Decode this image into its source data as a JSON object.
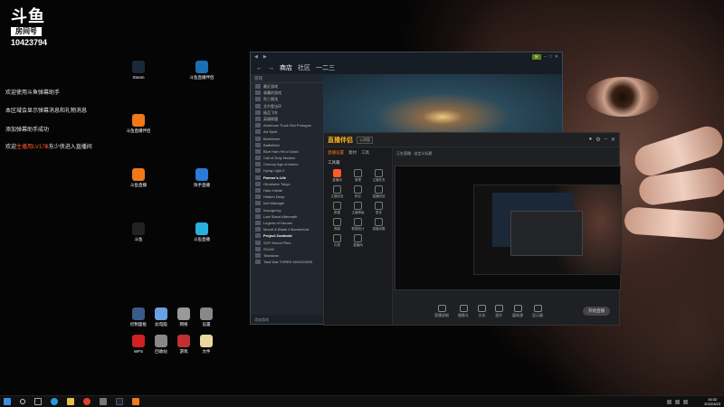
{
  "overlay": {
    "logo_text": "斗鱼",
    "room_label": "房间号",
    "room_number": "10423794",
    "chat": [
      {
        "pre": "欢迎使用斗鱼弹幕助手",
        "hl": "",
        "post": ""
      },
      {
        "pre": "本区域会显示弹幕消息和礼物消息",
        "hl": "",
        "post": ""
      },
      {
        "pre": "添加弹幕助手成功",
        "hl": "",
        "post": ""
      },
      {
        "pre": "欢迎",
        "hl": "主播用LV17Ⅲ",
        "post": "东少侠进入直播间"
      }
    ]
  },
  "desktop": {
    "icons": [
      {
        "id": "steam",
        "label": "Steam",
        "color": "#1b2838"
      },
      {
        "id": "douyu-tool",
        "label": "斗鱼直播伴侣",
        "color": "#1a6fb5"
      },
      {
        "id": "live1",
        "label": "斗鱼直播伴侣",
        "color": "#f07818"
      },
      {
        "id": "live2",
        "label": "斗鱼直播",
        "color": "#f07818"
      },
      {
        "id": "kuaishou",
        "label": "快手直播",
        "color": "#2a7ad8"
      },
      {
        "id": "douyu3",
        "label": "斗鱼",
        "color": "#222"
      },
      {
        "id": "qq",
        "label": "斗鱼直播",
        "color": "#2ab0e0"
      },
      {
        "id": "ctrl",
        "label": "控制面板",
        "color": "#3a5a8a"
      },
      {
        "id": "pc",
        "label": "此电脑",
        "color": "#6aa0e0"
      },
      {
        "id": "netdrive",
        "label": "网络",
        "color": "#999"
      },
      {
        "id": "settings",
        "label": "设置",
        "color": "#888"
      },
      {
        "id": "wps",
        "label": "WPS",
        "color": "#d02020"
      },
      {
        "id": "recycle",
        "label": "回收站",
        "color": "#888"
      },
      {
        "id": "games",
        "label": "游戏",
        "color": "#c03030"
      },
      {
        "id": "file",
        "label": "文件",
        "color": "#e8d8a0"
      }
    ]
  },
  "steam": {
    "nav": [
      "商店",
      "社区",
      "一二三"
    ],
    "store_badge": "好",
    "library_header": "游戏",
    "games": [
      {
        "name": "最近游戏",
        "bold": false
      },
      {
        "name": "收藏的游戏",
        "bold": false
      },
      {
        "name": "死亡搁浅",
        "bold": false
      },
      {
        "name": "艾尔登法环",
        "bold": false
      },
      {
        "name": "极品飞车",
        "bold": false
      },
      {
        "name": "英雄联盟",
        "bold": false
      },
      {
        "name": "American Truck Sim Prologue",
        "bold": false
      },
      {
        "name": "Art Spirit",
        "bold": false
      },
      {
        "name": "Bombbom",
        "bold": false
      },
      {
        "name": "Battlefield",
        "bold": false
      },
      {
        "name": "Blue Ham Hit or Dash",
        "bold": false
      },
      {
        "name": "Call of Duty Modern",
        "bold": false
      },
      {
        "name": "Century Age of Ashes",
        "bold": false
      },
      {
        "name": "Dying Light 2",
        "bold": false
      },
      {
        "name": "Farmer's Life",
        "bold": true
      },
      {
        "name": "Ghostwire Tokyo",
        "bold": false
      },
      {
        "name": "Halo Infinite",
        "bold": false
      },
      {
        "name": "Hidden Deep",
        "bold": false
      },
      {
        "name": "Idol Manager",
        "bold": false
      },
      {
        "name": "Insurgency",
        "bold": false
      },
      {
        "name": "Last Stand Aftermath",
        "bold": false
      },
      {
        "name": "Legend of Heroes",
        "bold": false
      },
      {
        "name": "Mount & Blade II Bannerlord",
        "bold": false
      },
      {
        "name": "Project Zomboid",
        "bold": true
      },
      {
        "name": "SCP Secret Files",
        "bold": false
      },
      {
        "name": "SCUM",
        "bold": false
      },
      {
        "name": "Teardown",
        "bold": false
      },
      {
        "name": "Total War THREE KINGDOMS",
        "bold": false
      }
    ],
    "footer": "添加游戏"
  },
  "tool": {
    "brand": "直播伴侣",
    "version": "公测版",
    "tabs": [
      "直播设置",
      "素材",
      "工具"
    ],
    "section": "工具箱",
    "grid": [
      {
        "label": "直播间",
        "hot": true
      },
      {
        "label": "管理",
        "hot": false
      },
      {
        "label": "主播任务",
        "hot": false
      },
      {
        "label": "主播信息",
        "hot": false
      },
      {
        "label": "粉丝",
        "hot": false
      },
      {
        "label": "直播回放",
        "hot": false
      },
      {
        "label": "数据",
        "hot": false
      },
      {
        "label": "主播等级",
        "hot": false
      },
      {
        "label": "更多",
        "hot": false
      },
      {
        "label": "弹幕",
        "hot": false
      },
      {
        "label": "数据统计",
        "hot": false
      },
      {
        "label": "直播设置",
        "hot": false
      },
      {
        "label": "礼物",
        "hot": false
      },
      {
        "label": "直播间",
        "hot": false
      }
    ],
    "topbar": "正在直播 · 自定义标题",
    "bottom": [
      "直播录制",
      "摄像头",
      "文本",
      "图片",
      "媒体源",
      "显示器"
    ],
    "start": "开始直播"
  },
  "taskbar": {
    "time": "16:32",
    "date": "2022/3/23"
  }
}
